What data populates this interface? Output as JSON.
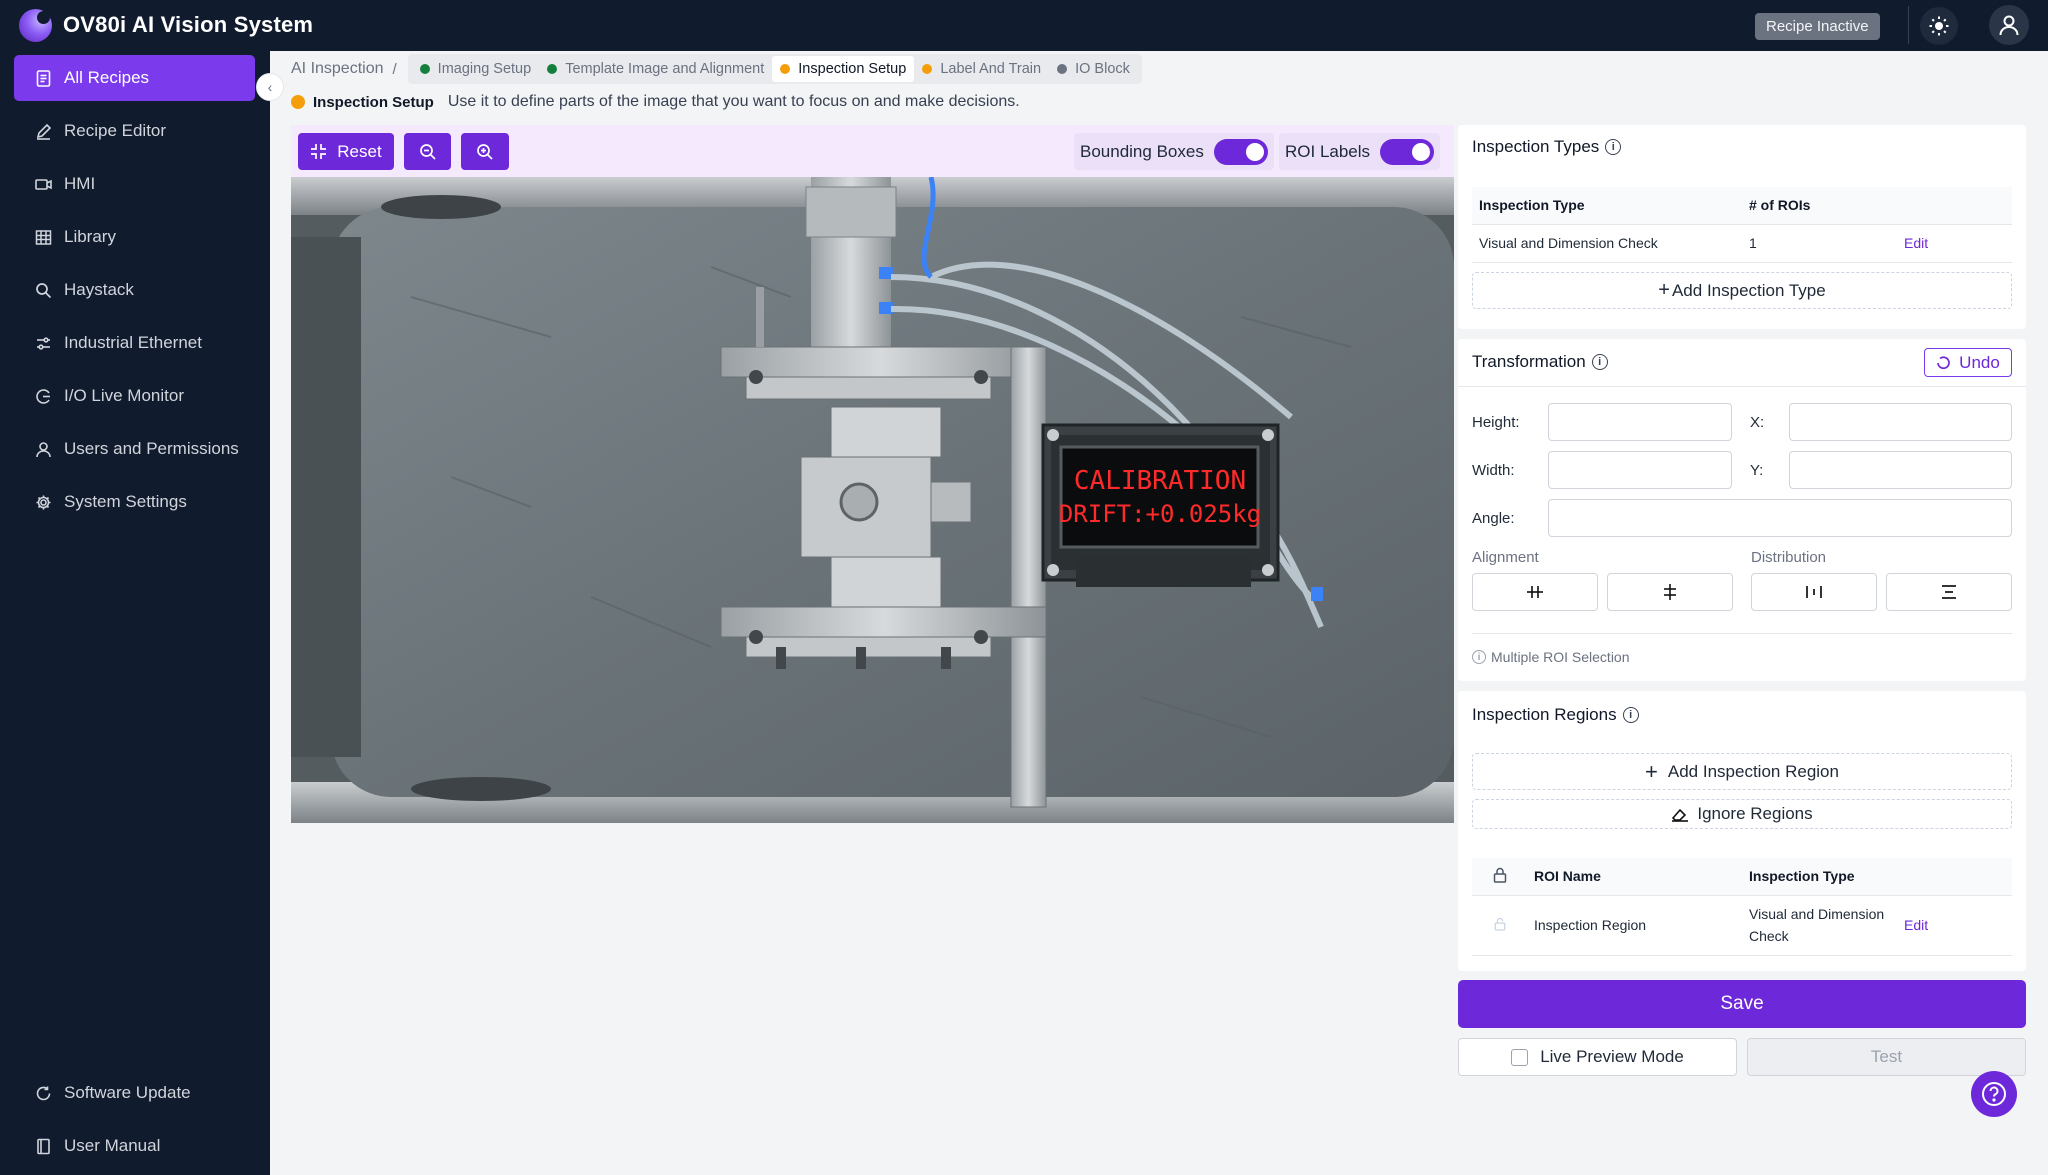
{
  "app": {
    "title": "OV80i AI Vision System",
    "recipe_status": "Recipe Inactive"
  },
  "sidebar": {
    "items": [
      {
        "label": "All Recipes",
        "icon": "document-list-icon"
      },
      {
        "label": "Recipe Editor",
        "icon": "pencil-icon"
      },
      {
        "label": "HMI",
        "icon": "video-icon"
      },
      {
        "label": "Library",
        "icon": "grid-icon"
      },
      {
        "label": "Haystack",
        "icon": "search-icon"
      },
      {
        "label": "Industrial Ethernet",
        "icon": "network-icon"
      },
      {
        "label": "I/O Live Monitor",
        "icon": "monitor-icon"
      },
      {
        "label": "Users and Permissions",
        "icon": "user-icon"
      },
      {
        "label": "System Settings",
        "icon": "gear-icon"
      }
    ],
    "bottom": [
      {
        "label": "Software Update",
        "icon": "refresh-icon"
      },
      {
        "label": "User Manual",
        "icon": "book-icon"
      }
    ]
  },
  "breadcrumb": {
    "root": "AI Inspection",
    "steps": [
      {
        "label": "Imaging Setup",
        "color": "#15803d"
      },
      {
        "label": "Template Image and Alignment",
        "color": "#15803d"
      },
      {
        "label": "Inspection Setup",
        "color": "#f59e0b"
      },
      {
        "label": "Label And Train",
        "color": "#f59e0b"
      },
      {
        "label": "IO Block",
        "color": "#6b7280"
      }
    ]
  },
  "section": {
    "name": "Inspection Setup",
    "description": "Use it to define parts of the image that you want to focus on and make decisions."
  },
  "toolbar": {
    "reset_label": "Reset",
    "bounding_boxes_label": "Bounding Boxes",
    "bounding_boxes_on": true,
    "roi_labels_label": "ROI Labels",
    "roi_labels_on": true
  },
  "image": {
    "display_line1": "CALIBRATION",
    "display_line2": "DRIFT:+0.025kg"
  },
  "inspection_types": {
    "title": "Inspection Types",
    "headers": [
      "Inspection Type",
      "# of ROIs"
    ],
    "rows": [
      {
        "type": "Visual and Dimension Check",
        "rois": "1",
        "action": "Edit"
      }
    ],
    "add_label": "Add Inspection Type"
  },
  "transformation": {
    "title": "Transformation",
    "undo_label": "Undo",
    "height_label": "Height:",
    "width_label": "Width:",
    "x_label": "X:",
    "y_label": "Y:",
    "angle_label": "Angle:",
    "alignment_label": "Alignment",
    "distribution_label": "Distribution",
    "multi_roi_note": "Multiple ROI Selection"
  },
  "inspection_regions": {
    "title": "Inspection Regions",
    "add_label": "Add Inspection Region",
    "ignore_label": "Ignore Regions",
    "headers": [
      "ROI Name",
      "Inspection Type"
    ],
    "rows": [
      {
        "name": "Inspection Region",
        "type_line1": "Visual and Dimension",
        "type_line2": "Check",
        "action": "Edit"
      }
    ]
  },
  "actions": {
    "save_label": "Save",
    "live_preview_label": "Live Preview Mode",
    "test_label": "Test"
  }
}
